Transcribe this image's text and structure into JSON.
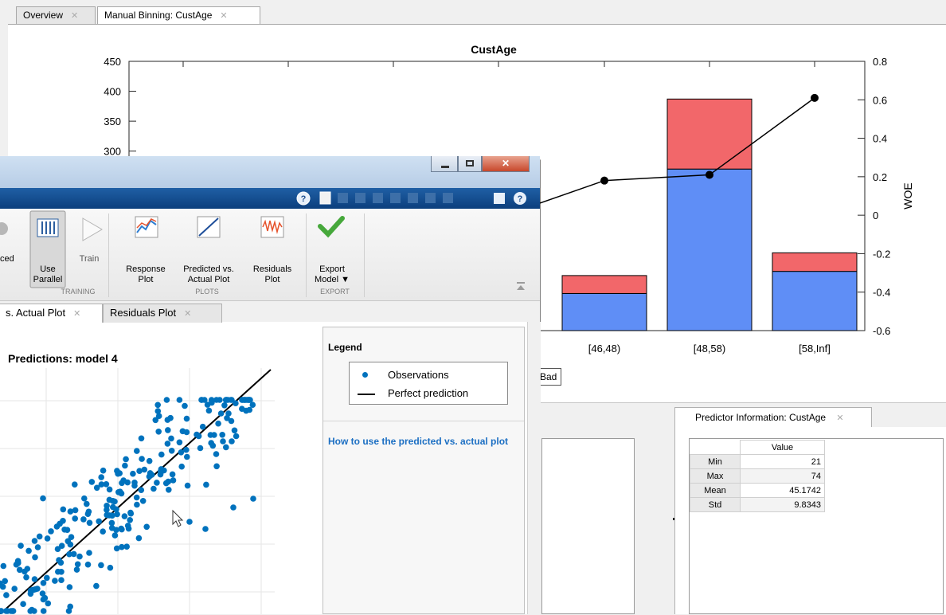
{
  "back_window": {
    "tabs": [
      {
        "label": "Overview",
        "close": "✕"
      },
      {
        "label": "Manual Binning: CustAge",
        "close": "✕"
      }
    ],
    "chart_data": {
      "type": "bar",
      "title": "CustAge",
      "categories_visible": [
        "[46,48)",
        "[48,58)",
        "[58,Inf]"
      ],
      "stacked_series": [
        {
          "color": "#5f8ef6",
          "values": [
            62,
            270,
            99
          ]
        },
        {
          "color": "#f2676a",
          "values": [
            30,
            117,
            31
          ]
        }
      ],
      "woe_line": {
        "values": [
          0.18,
          0.21,
          0.61
        ],
        "color": "#000000"
      },
      "left_axis": {
        "ticks": [
          "450",
          "400",
          "350",
          "300"
        ],
        "ylim": [
          0,
          450
        ]
      },
      "right_axis": {
        "label": "WOE",
        "ticks": [
          "0.8",
          "0.6",
          "0.4",
          "0.2",
          "0",
          "-0.2",
          "-0.4",
          "-0.6"
        ],
        "ylim": [
          -0.6,
          0.8
        ]
      }
    },
    "legend_fragment": "Bad",
    "predictor_info": {
      "tab_label": "Predictor Information: CustAge",
      "close": "✕",
      "column_header": "Value",
      "rows": [
        {
          "label": "Min",
          "value": "21"
        },
        {
          "label": "Max",
          "value": "74"
        },
        {
          "label": "Mean",
          "value": "45.1742"
        },
        {
          "label": "Std",
          "value": "9.8343"
        }
      ]
    }
  },
  "front_window": {
    "ribbon": {
      "buttons": [
        {
          "label": "ced"
        },
        {
          "label": "Use\nParallel"
        },
        {
          "label": "Train"
        },
        {
          "label": "Response\nPlot"
        },
        {
          "label": "Predicted vs.\nActual Plot"
        },
        {
          "label": "Residuals\nPlot"
        },
        {
          "label": "Export\nModel ▼"
        }
      ],
      "groups": [
        "TRAINING",
        "PLOTS",
        "EXPORT"
      ]
    },
    "tabs": [
      {
        "label": "s. Actual Plot",
        "close": "✕"
      },
      {
        "label": "Residuals Plot",
        "close": "✕"
      }
    ],
    "plot_title": "Predictions: model 4",
    "legend": {
      "heading": "Legend",
      "items": [
        "Observations",
        "Perfect prediction"
      ],
      "help_link": "How to use the predicted vs. actual plot"
    },
    "scatter_color": "#0072bd"
  }
}
